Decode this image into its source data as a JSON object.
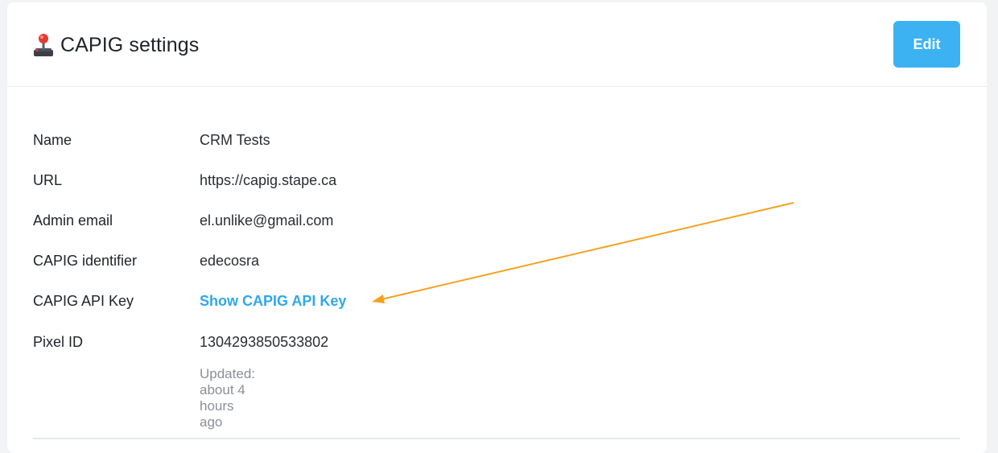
{
  "header": {
    "icon": "joystick-icon",
    "title": "CAPIG settings",
    "edit_label": "Edit"
  },
  "details": [
    {
      "label": "Name",
      "value": "CRM Tests"
    },
    {
      "label": "URL",
      "value": "https://capig.stape.ca"
    },
    {
      "label": "Admin email",
      "value": "el.unlike@gmail.com"
    },
    {
      "label": "CAPIG identifier",
      "value": "edecosra"
    },
    {
      "label": "CAPIG API Key",
      "value": "Show CAPIG API Key"
    },
    {
      "label": "Pixel ID",
      "value": "1304293850533802"
    }
  ],
  "updated": "Updated: about 4 hours ago",
  "colors": {
    "accent": "#3cb2f2",
    "link": "#2ea8f0",
    "annotation_arrow": "#f5a11f"
  }
}
